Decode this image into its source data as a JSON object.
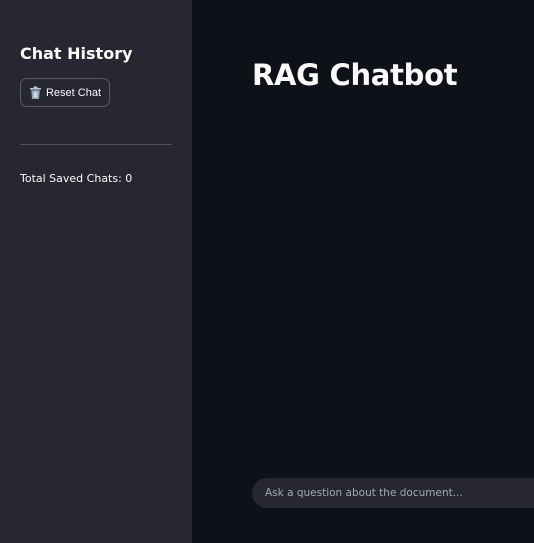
{
  "sidebar": {
    "title": "Chat History",
    "reset_button": {
      "label": "Reset Chat",
      "icon": "trash-icon"
    },
    "saved_count_text": "Total Saved Chats: 0"
  },
  "main": {
    "title": "RAG Chatbot",
    "chat_input": {
      "value": "",
      "placeholder": "Ask a question about the document..."
    }
  },
  "colors": {
    "main_background": "#0e1117",
    "sidebar_background": "#262730",
    "text": "#fafafa",
    "placeholder": "#a3a8b4"
  }
}
